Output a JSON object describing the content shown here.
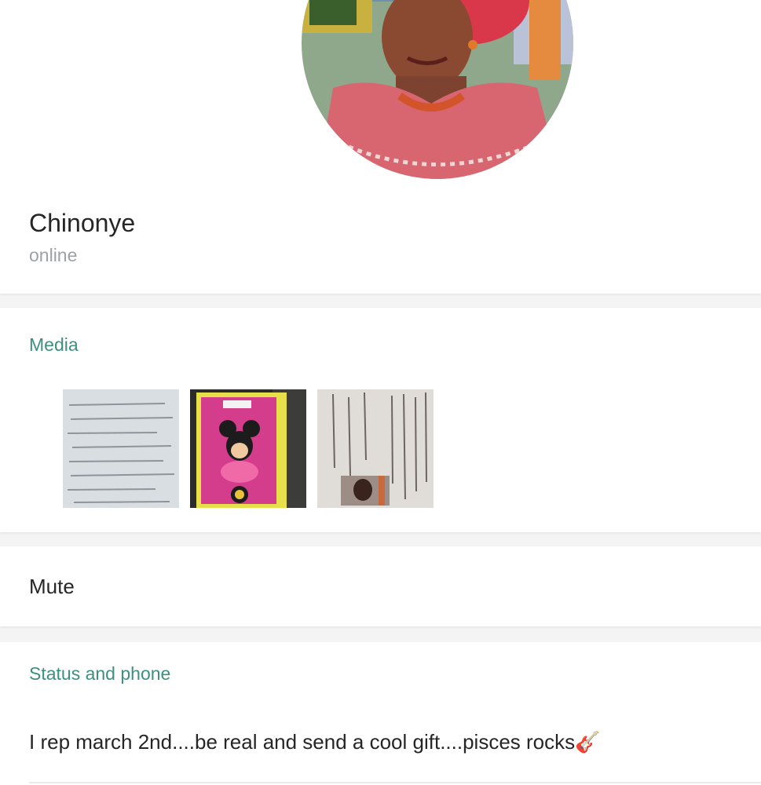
{
  "profile": {
    "name": "Chinonye",
    "presence": "online"
  },
  "media": {
    "title": "Media",
    "items": [
      {
        "kind": "handwritten-note-photo"
      },
      {
        "kind": "minnie-mouse-card-photo"
      },
      {
        "kind": "id-document-photo"
      }
    ]
  },
  "mute": {
    "label": "Mute"
  },
  "about": {
    "title": "Status and phone",
    "status_text": "I rep march 2nd....be real and send a cool gift....pisces rocks🎸"
  },
  "colors": {
    "accent": "#3d8f7f",
    "secondary_text": "#9ea2a5",
    "primary_text": "#262626",
    "background": "#f4f4f4"
  }
}
